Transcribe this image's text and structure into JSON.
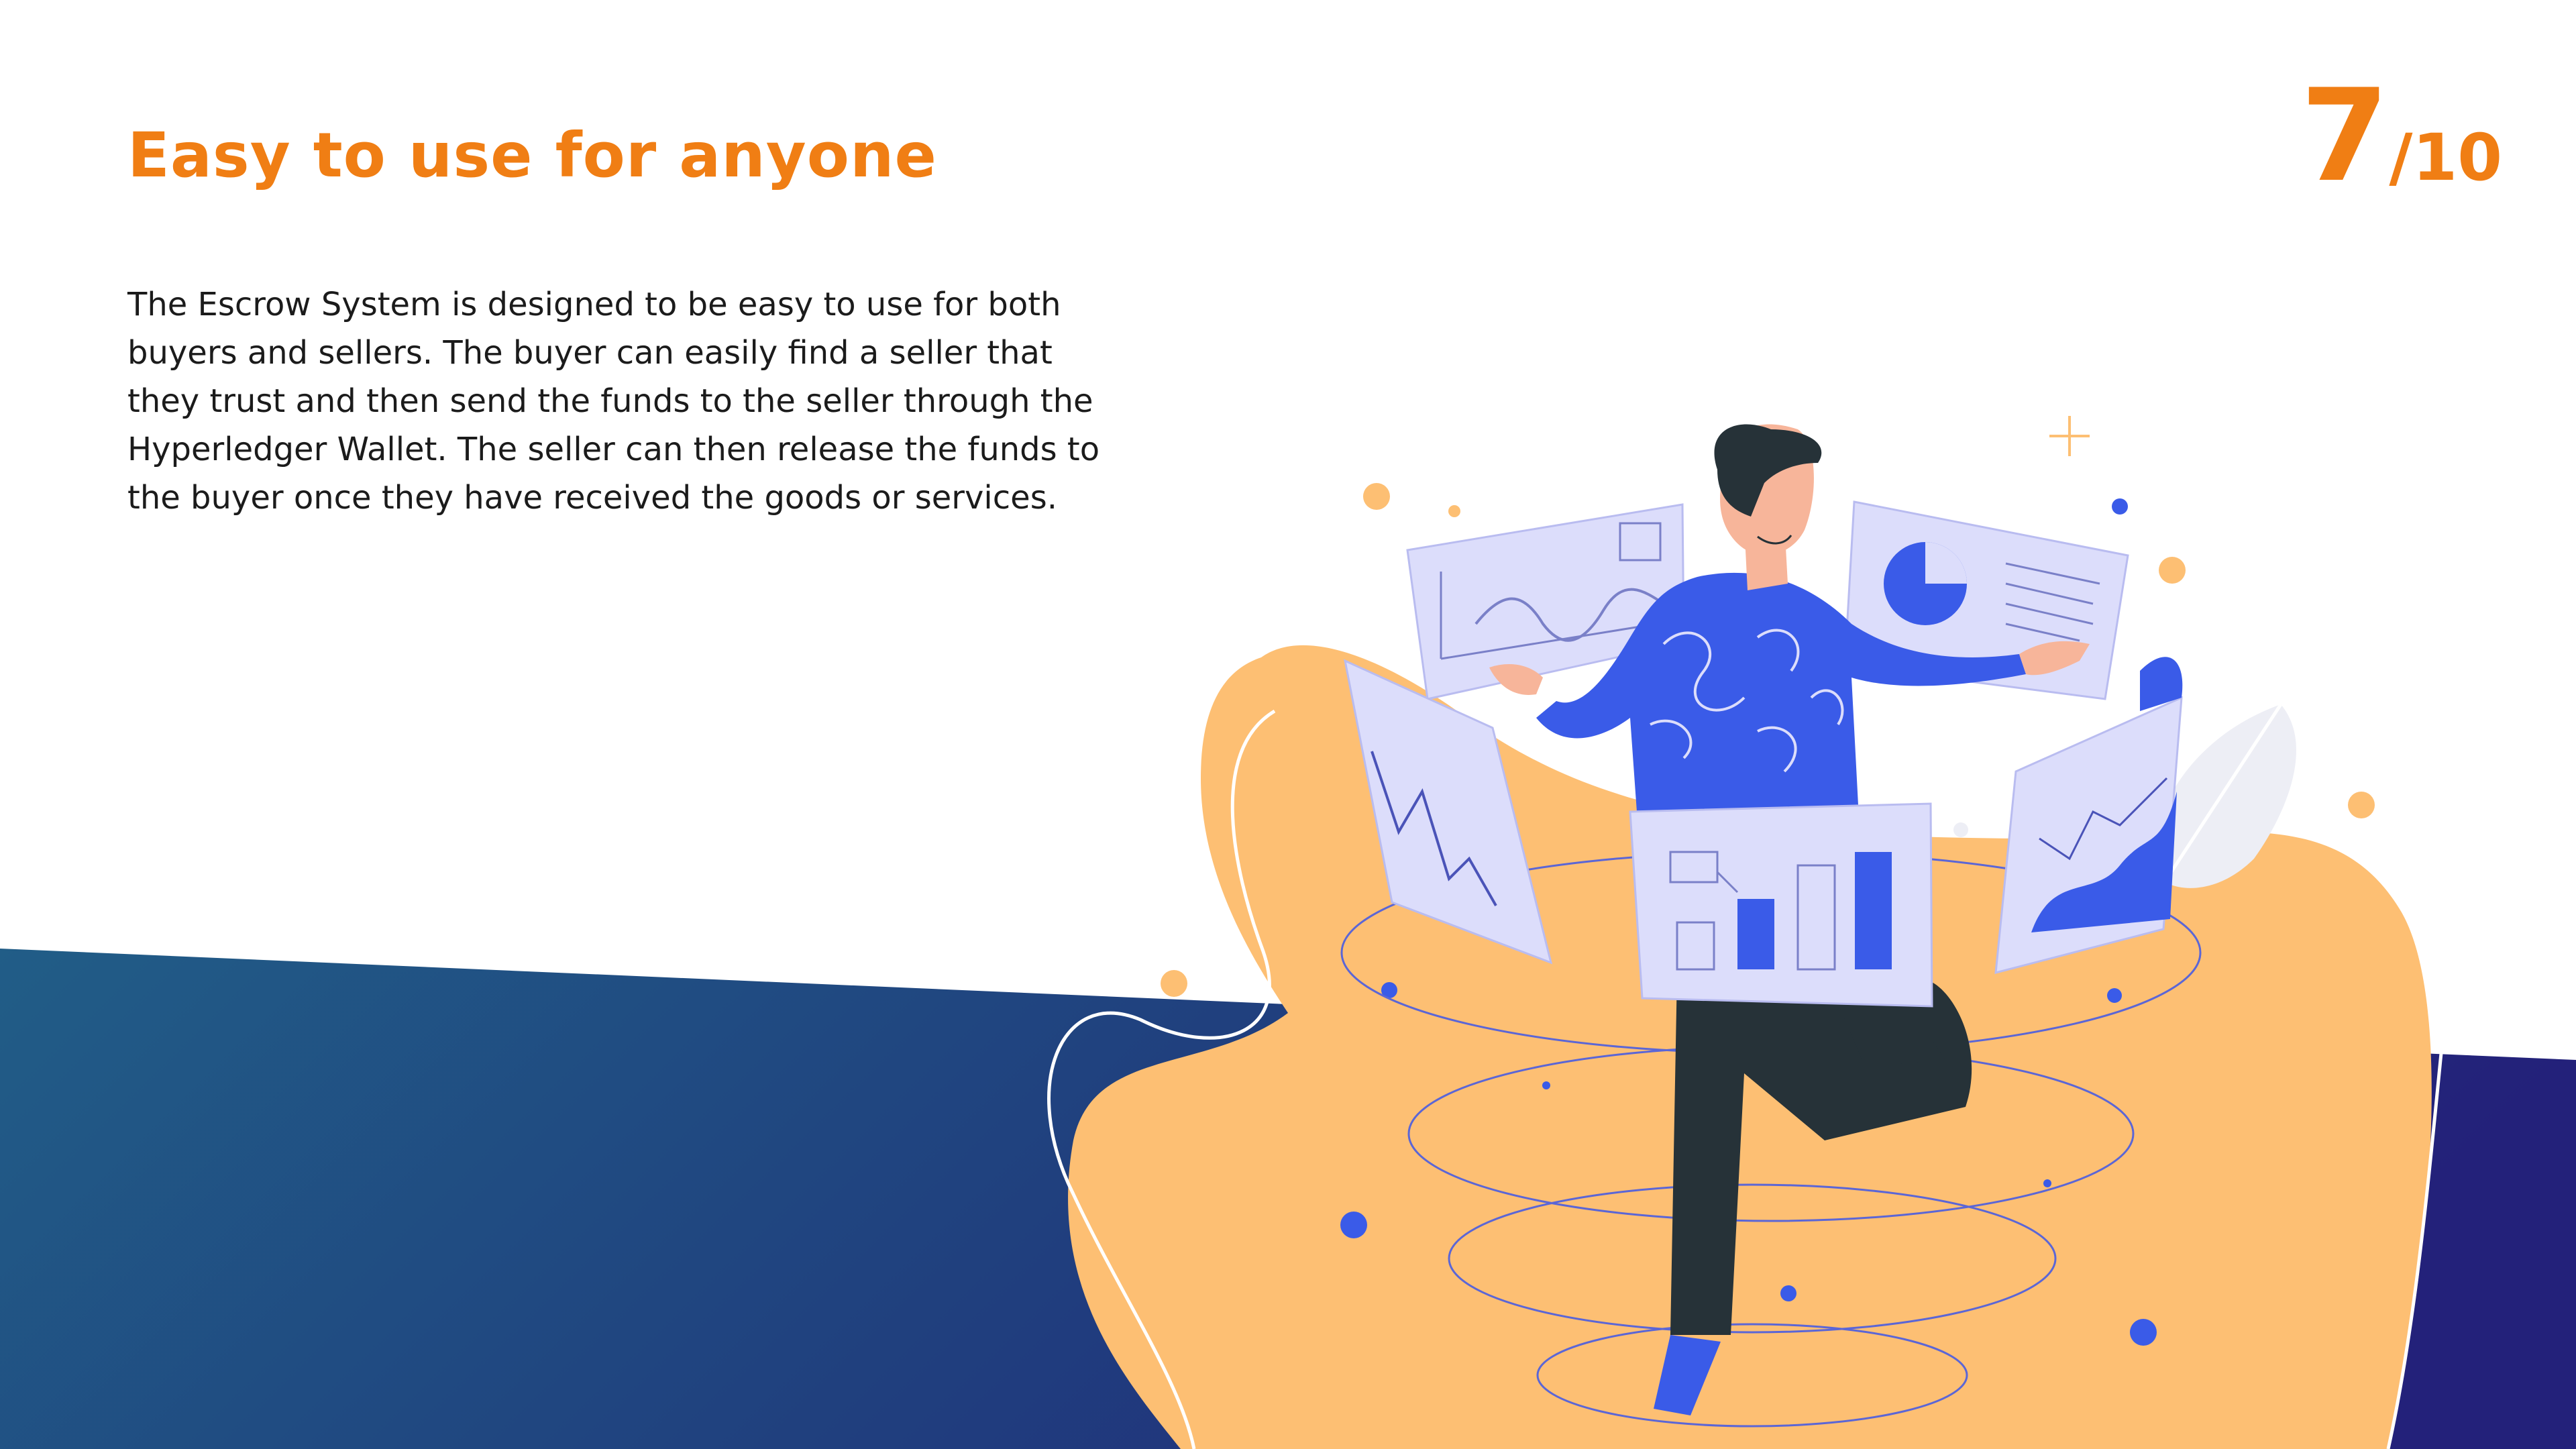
{
  "slide": {
    "title": "Easy to use for anyone",
    "page_current": "7",
    "page_separator": "/",
    "page_total": "10",
    "body": "The Escrow System is designed to be easy to use for both buyers and sellers. The buyer can easily find a seller that they trust and then send the funds to the seller through the Hyperledger Wallet. The seller can then release the funds to the buyer once they have received the goods or services."
  },
  "colors": {
    "accent_orange": "#F07E14",
    "band_start": "#215D87",
    "band_end": "#23217A",
    "blob": "#FDBF73",
    "shirt_blue": "#3A5BE8",
    "panel": "#DCDDFB",
    "pants": "#263238"
  },
  "illustration": {
    "subject": "person-with-floating-dashboards",
    "icons": [
      "line-chart-panel",
      "pie-chart-panel",
      "bar-chart-panel",
      "area-chart-panel",
      "leaf-decoration",
      "sparkle-star"
    ]
  }
}
